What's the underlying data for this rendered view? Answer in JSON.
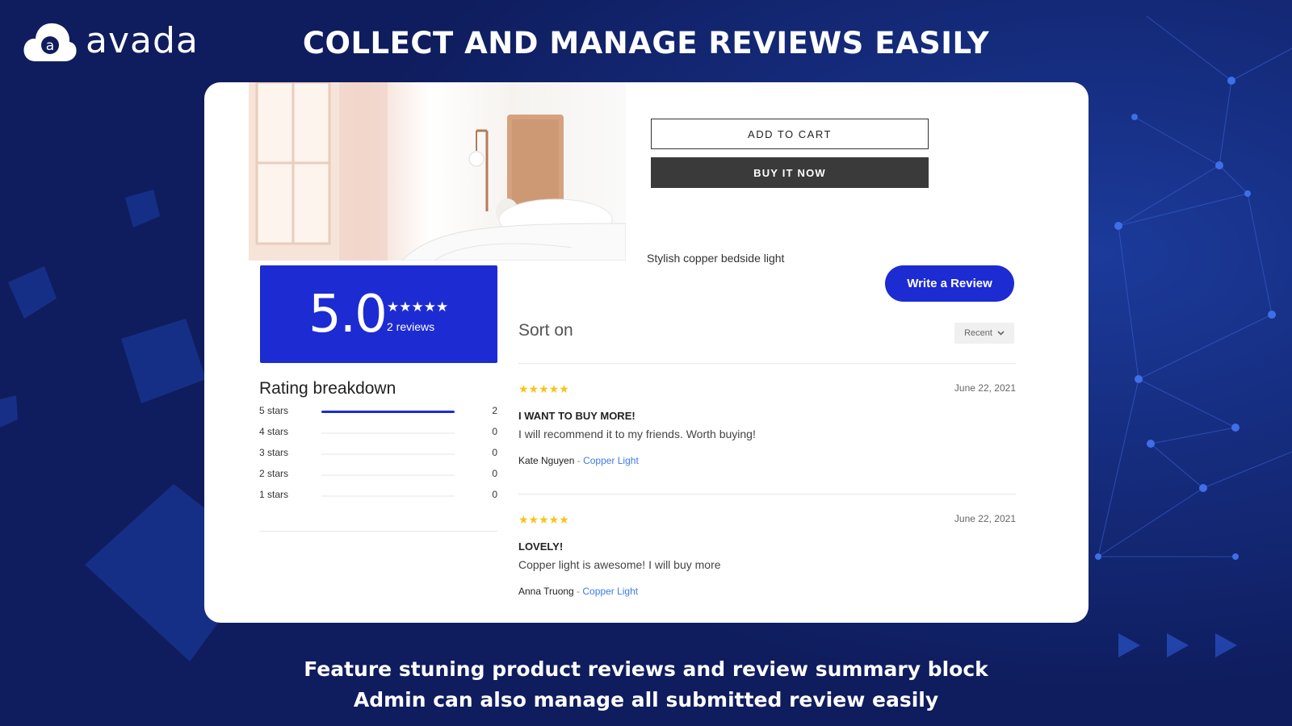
{
  "brand": {
    "name": "avada",
    "logo_letter": "a"
  },
  "headline": "COLLECT AND MANAGE REVIEWS EASILY",
  "product": {
    "add_to_cart": "ADD TO CART",
    "buy_now": "BUY IT NOW",
    "description": "Stylish copper bedside light"
  },
  "summary": {
    "score": "5.0",
    "stars": "★★★★★",
    "count": "2 reviews"
  },
  "breakdown": {
    "title": "Rating breakdown",
    "rows": [
      {
        "label": "5 stars",
        "count": "2",
        "fraction": 1.0
      },
      {
        "label": "4 stars",
        "count": "0",
        "fraction": 0
      },
      {
        "label": "3 stars",
        "count": "0",
        "fraction": 0
      },
      {
        "label": "2 stars",
        "count": "0",
        "fraction": 0
      },
      {
        "label": "1 stars",
        "count": "0",
        "fraction": 0
      }
    ]
  },
  "write_review_label": "Write a Review",
  "sort": {
    "label": "Sort on",
    "selected": "Recent"
  },
  "reviews": [
    {
      "stars": "★★★★★",
      "date": "June 22, 2021",
      "title": "I WANT TO BUY MORE!",
      "body": "I will recommend it to my friends. Worth buying!",
      "author": "Kate Nguyen",
      "separator": " - ",
      "product": "Copper Light"
    },
    {
      "stars": "★★★★★",
      "date": "June 22, 2021",
      "title": "LOVELY!",
      "body": "Copper light is awesome! I will buy more",
      "author": "Anna Truong",
      "separator": " - ",
      "product": "Copper Light"
    }
  ],
  "caption": {
    "line1": "Feature stuning product reviews and review summary block",
    "line2": "Admin can also manage all submitted review easily"
  },
  "colors": {
    "background": "#0f1d5e",
    "accent_blue": "#1d2bd2",
    "star_yellow": "#f5c518",
    "link_blue": "#3c7be8"
  }
}
